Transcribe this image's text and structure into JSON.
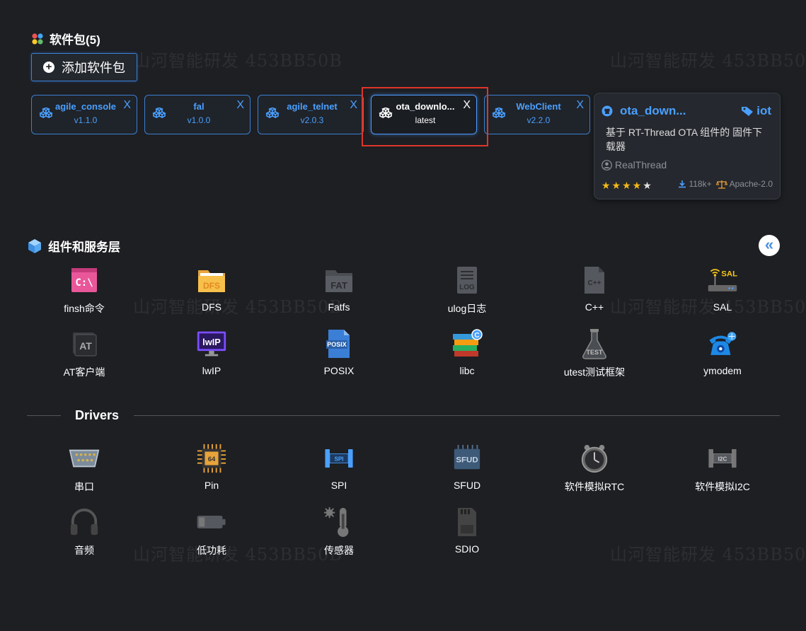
{
  "watermark": "山河智能研发 453BB50B",
  "packages_section": {
    "title": "软件包(5)",
    "add_button": "添加软件包"
  },
  "packages": [
    {
      "name": "agile_console",
      "version": "v1.1.0"
    },
    {
      "name": "fal",
      "version": "v1.0.0"
    },
    {
      "name": "agile_telnet",
      "version": "v2.0.3"
    },
    {
      "name": "ota_downlo...",
      "version": "latest"
    },
    {
      "name": "WebClient",
      "version": "v2.2.0"
    }
  ],
  "close_glyph": "X",
  "card": {
    "title": "ota_down...",
    "tag": "iot",
    "description": "基于 RT-Thread OTA 组件的 固件下载器",
    "author": "RealThread",
    "rating": 4,
    "stars": "★★★★★",
    "downloads": "118k+",
    "license": "Apache-2.0"
  },
  "components_section": {
    "title": "组件和服务层"
  },
  "components": [
    {
      "label": "finsh命令",
      "icon": "terminal-icon"
    },
    {
      "label": "DFS",
      "icon": "folder-icon"
    },
    {
      "label": "Fatfs",
      "icon": "fat-folder-icon"
    },
    {
      "label": "ulog日志",
      "icon": "log-icon"
    },
    {
      "label": "C++",
      "icon": "cpp-file-icon"
    },
    {
      "label": "SAL",
      "icon": "router-icon"
    },
    {
      "label": "AT客户端",
      "icon": "at-icon"
    },
    {
      "label": "lwIP",
      "icon": "monitor-icon"
    },
    {
      "label": "POSIX",
      "icon": "posix-file-icon"
    },
    {
      "label": "libc",
      "icon": "books-icon"
    },
    {
      "label": "utest测试框架",
      "icon": "flask-icon"
    },
    {
      "label": "ymodem",
      "icon": "phone-icon"
    }
  ],
  "drivers_section": {
    "title": "Drivers"
  },
  "drivers": [
    {
      "label": "串口",
      "icon": "serial-port-icon"
    },
    {
      "label": "Pin",
      "icon": "chip-icon"
    },
    {
      "label": "SPI",
      "icon": "spi-icon"
    },
    {
      "label": "SFUD",
      "icon": "sfud-chip-icon"
    },
    {
      "label": "软件模拟RTC",
      "icon": "clock-icon"
    },
    {
      "label": "软件模拟I2C",
      "icon": "i2c-icon"
    },
    {
      "label": "音频",
      "icon": "headphones-icon"
    },
    {
      "label": "低功耗",
      "icon": "battery-icon"
    },
    {
      "label": "传感器",
      "icon": "thermometer-icon"
    },
    {
      "label": "SDIO",
      "icon": "sd-card-icon"
    }
  ],
  "collapse_glyph": "«"
}
